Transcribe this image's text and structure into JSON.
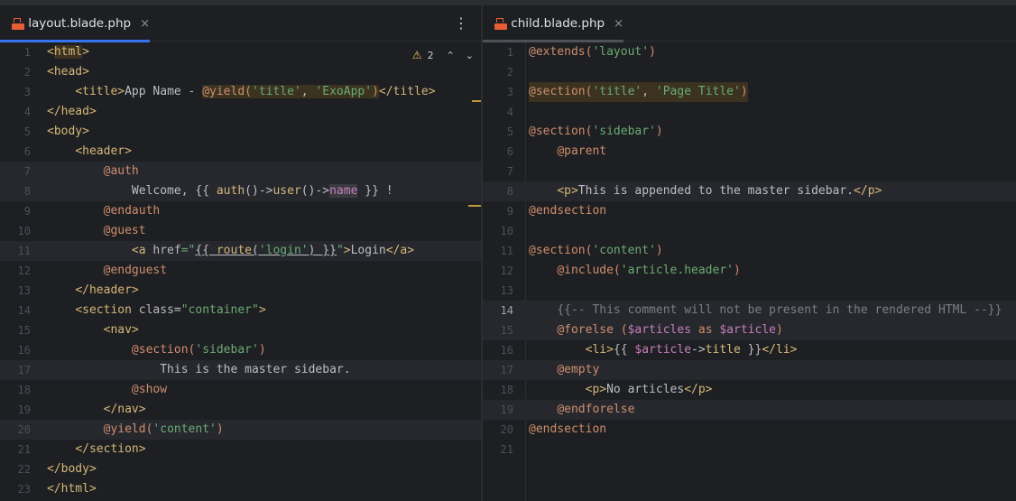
{
  "left_pane": {
    "tab": {
      "label": "layout.blade.php",
      "close": "×"
    },
    "menu": "⋮",
    "inspection": {
      "warning_count": "2",
      "warning_icon": "⚠",
      "up": "⌃",
      "down": "⌄"
    },
    "lines": [
      {
        "n": "1"
      },
      {
        "n": "2"
      },
      {
        "n": "3"
      },
      {
        "n": "4"
      },
      {
        "n": "5"
      },
      {
        "n": "6"
      },
      {
        "n": "7"
      },
      {
        "n": "8"
      },
      {
        "n": "9"
      },
      {
        "n": "10"
      },
      {
        "n": "11"
      },
      {
        "n": "12"
      },
      {
        "n": "13"
      },
      {
        "n": "14"
      },
      {
        "n": "15"
      },
      {
        "n": "16"
      },
      {
        "n": "17"
      },
      {
        "n": "18"
      },
      {
        "n": "19"
      },
      {
        "n": "20"
      },
      {
        "n": "21"
      },
      {
        "n": "22"
      },
      {
        "n": "23"
      }
    ],
    "text": {
      "l3_title_open": "<title>",
      "l3_app": "App Name - ",
      "l3_yield": "@yield(",
      "l3_arg1": "'title'",
      "l3_comma": ", ",
      "l3_arg2": "'ExoApp'",
      "l3_close": ")",
      "l3_title_close": "</title>",
      "l8_welcome": "Welcome, ",
      "l8_open": "{{ ",
      "l8_auth": "auth",
      "l8_p1": "()->",
      "l8_user": "user",
      "l8_p2": "()->",
      "l8_name": "name",
      "l8_close": " }}",
      "l8_excl": " !",
      "l11_a": "<a ",
      "l11_href": "href",
      "l11_eq": "=\"",
      "l11_blade_open": "{{ ",
      "l11_route": "route",
      "l11_paren": "(",
      "l11_login_arg": "'login'",
      "l11_paren_close": ")",
      "l11_blade_close": " }}",
      "l11_q": "\"",
      "l11_gt": ">",
      "l11_login": "Login",
      "l11_a_close": "</a>",
      "l14_section": "<section ",
      "l14_class": "class",
      "l14_eq": "=",
      "l14_val": "\"container\"",
      "l14_gt": ">",
      "l16_section": "@section(",
      "l16_arg": "'sidebar'",
      "l16_close": ")",
      "l17_text": "This is the master sidebar.",
      "l20_yield": "@yield(",
      "l20_arg": "'content'",
      "l20_close": ")"
    }
  },
  "right_pane": {
    "tab": {
      "label": "child.blade.php",
      "close": "×"
    },
    "lines": [
      {
        "n": "1"
      },
      {
        "n": "2"
      },
      {
        "n": "3"
      },
      {
        "n": "4"
      },
      {
        "n": "5"
      },
      {
        "n": "6"
      },
      {
        "n": "7"
      },
      {
        "n": "8"
      },
      {
        "n": "9"
      },
      {
        "n": "10"
      },
      {
        "n": "11"
      },
      {
        "n": "12"
      },
      {
        "n": "13"
      },
      {
        "n": "14"
      },
      {
        "n": "15"
      },
      {
        "n": "16"
      },
      {
        "n": "17"
      },
      {
        "n": "18"
      },
      {
        "n": "19"
      },
      {
        "n": "20"
      },
      {
        "n": "21"
      }
    ],
    "text": {
      "l1_extends": "@extends(",
      "l1_arg": "'layout'",
      "l1_close": ")",
      "l3_section": "@section(",
      "l3_arg1": "'title'",
      "l3_comma": ", ",
      "l3_arg2": "'Page Title'",
      "l3_close": ")",
      "l5_section": "@section(",
      "l5_arg": "'sidebar'",
      "l5_close": ")",
      "l6_parent": "@parent",
      "l8_p": "<p>",
      "l8_text": "This is appended to the master sidebar.",
      "l8_p_close": "</p>",
      "l9_end": "@endsection",
      "l11_section": "@section(",
      "l11_arg": "'content'",
      "l11_close": ")",
      "l12_include": "@include(",
      "l12_arg": "'article.header'",
      "l12_close": ")",
      "l14_comment": "{{-- This comment will not be present in the rendered HTML --}}",
      "l15_forelse": "@forelse (",
      "l15_var1": "$articles",
      "l15_as": " as ",
      "l15_var2": "$article",
      "l15_close": ")",
      "l16_li": "<li>",
      "l16_open": "{{ ",
      "l16_var": "$article",
      "l16_arrow": "->",
      "l16_prop": "title",
      "l16_close": " }}",
      "l16_li_close": "</li>",
      "l17_empty": "@empty",
      "l18_p": "<p>",
      "l18_text": "No articles",
      "l18_p_close": "</p>",
      "l19_end": "@endforelse",
      "l20_end": "@endsection"
    }
  },
  "colors": {
    "background": "#1e1f22",
    "tag": "#d5b778",
    "string": "#6aab73",
    "directive": "#cf8e6d",
    "comment": "#7a7e85",
    "active_tab_accent": "#3574f0"
  }
}
